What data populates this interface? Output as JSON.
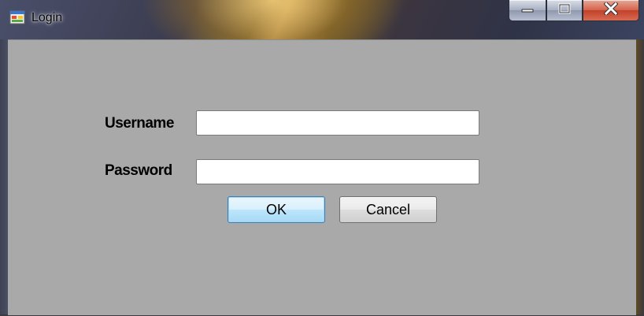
{
  "window": {
    "title": "Login",
    "icon": "windows-form-icon",
    "caption_buttons": {
      "minimize": "minimize-icon",
      "maximize": "maximize-icon",
      "close": "close-icon"
    }
  },
  "form": {
    "username_label": "Username",
    "username_value": "",
    "password_label": "Password",
    "password_value": "",
    "ok_label": "OK",
    "cancel_label": "Cancel"
  },
  "colors": {
    "client_background": "#a9a9a9",
    "default_button_border": "#3c7fb1",
    "close_button": "#c2412a"
  }
}
